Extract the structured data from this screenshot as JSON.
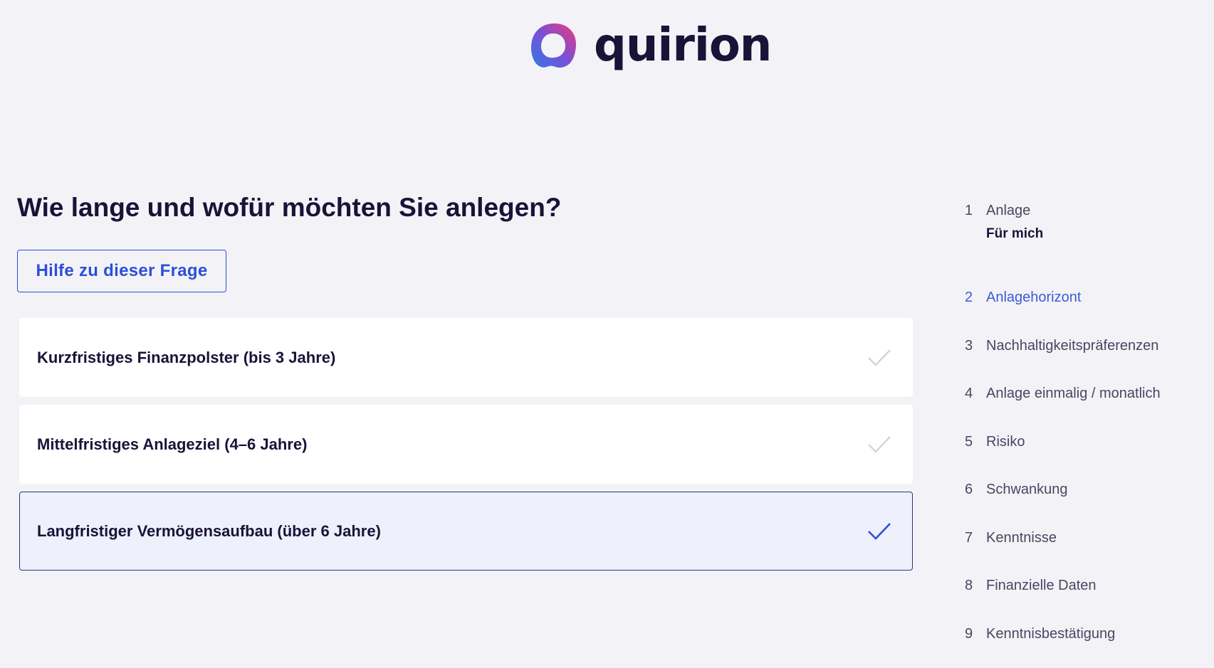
{
  "brand": {
    "name": "quirion",
    "colors": {
      "primary": "#1b1238",
      "accent": "#2b4fd8",
      "selected_bg": "#eef0fb"
    }
  },
  "main": {
    "question": "Wie lange und wofür möchten Sie anlegen?",
    "help_label": "Hilfe zu dieser Frage",
    "options": [
      {
        "label": "Kurzfristiges Finanzpolster (bis 3 Jahre)",
        "selected": false,
        "icon": "check-icon"
      },
      {
        "label": "Mittelfristiges Anlageziel (4–6 Jahre)",
        "selected": false,
        "icon": "check-icon"
      },
      {
        "label": "Langfristiger Vermögensaufbau (über 6 Jahre)",
        "selected": true,
        "icon": "check-icon"
      }
    ]
  },
  "steps": [
    {
      "number": "1",
      "label": "Anlage",
      "sublabel": "Für mich"
    },
    {
      "number": "2",
      "label": "Anlagehorizont",
      "active": true
    },
    {
      "number": "3",
      "label": "Nachhaltigkeitspräferenzen"
    },
    {
      "number": "4",
      "label": "Anlage einmalig / monatlich"
    },
    {
      "number": "5",
      "label": "Risiko"
    },
    {
      "number": "6",
      "label": "Schwankung"
    },
    {
      "number": "7",
      "label": "Kenntnisse"
    },
    {
      "number": "8",
      "label": "Finanzielle Daten"
    },
    {
      "number": "9",
      "label": "Kenntnisbestätigung"
    }
  ]
}
